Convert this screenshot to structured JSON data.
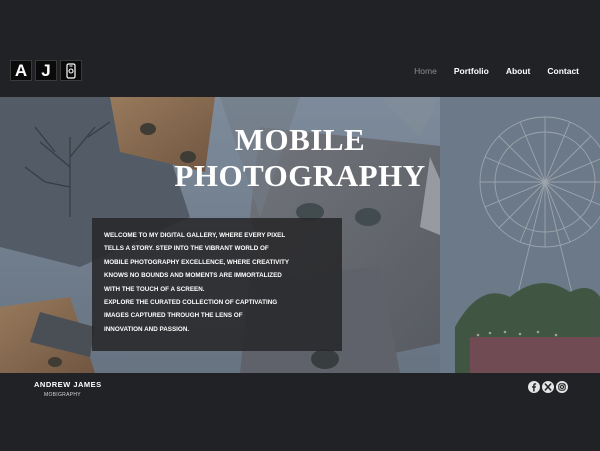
{
  "header": {
    "logo_letters": [
      "A",
      "J"
    ],
    "nav": [
      {
        "label": "Home",
        "active": true
      },
      {
        "label": "Portfolio",
        "active": false
      },
      {
        "label": "About",
        "active": false
      },
      {
        "label": "Contact",
        "active": false
      }
    ]
  },
  "hero": {
    "title_line1": "MOBILE",
    "title_line2": "PHOTOGRAPHY",
    "intro_lines": [
      "WELCOME TO MY DIGITAL GALLERY, WHERE EVERY PIXEL",
      "TELLS A STORY. STEP INTO THE VIBRANT WORLD OF",
      "MOBILE PHOTOGRAPHY EXCELLENCE, WHERE CREATIVITY",
      "KNOWS NO BOUNDS AND MOMENTS ARE IMMORTALIZED",
      "WITH THE TOUCH OF A SCREEN.",
      "EXPLORE THE CURATED COLLECTION OF CAPTIVATING",
      "IMAGES CAPTURED THROUGH THE LENS OF",
      "INNOVATION AND PASSION."
    ]
  },
  "footer": {
    "name": "ANDREW JAMES",
    "subtitle": "MOBIGRAPHY",
    "social_icons": [
      "facebook-icon",
      "x-icon",
      "instagram-icon"
    ]
  },
  "colors": {
    "background": "#202225",
    "nav_active": "#8a8d92",
    "text": "#ffffff"
  }
}
